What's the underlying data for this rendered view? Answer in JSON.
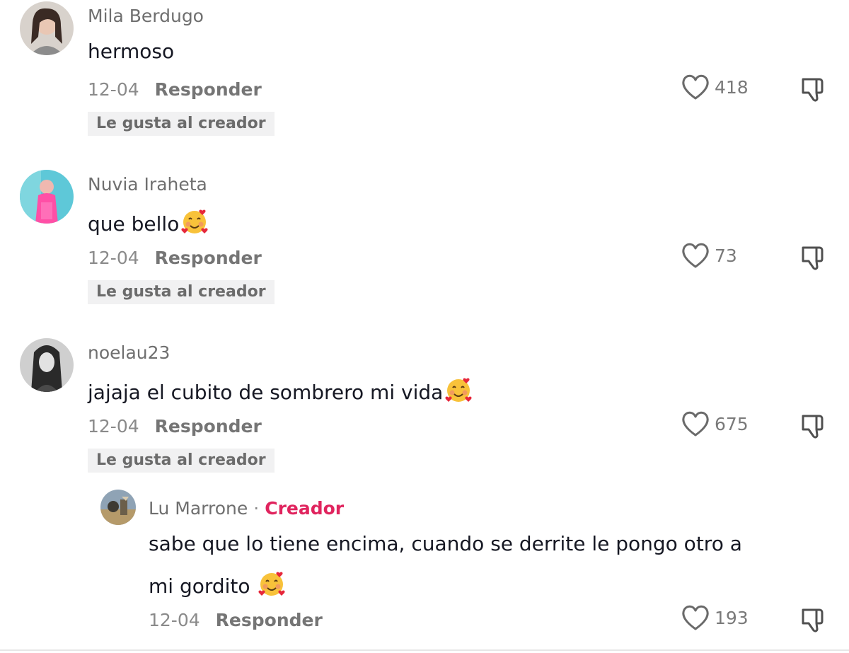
{
  "comments": [
    {
      "username": "Mila Berdugo",
      "text": "hermoso",
      "date": "12-04",
      "reply": "Responder",
      "badge": "Le gusta al creador",
      "likes": "418"
    },
    {
      "username": "Nuvia Iraheta",
      "text": "que bello",
      "date": "12-04",
      "reply": "Responder",
      "badge": "Le gusta al creador",
      "likes": "73"
    },
    {
      "username": "noelau23",
      "text": "jajaja el cubito de sombrero mi vida",
      "date": "12-04",
      "reply": "Responder",
      "badge": "Le gusta al creador",
      "likes": "675"
    }
  ],
  "reply_comment": {
    "username": "Lu Marrone",
    "separator": "·",
    "creator_label": "Creador",
    "text_line1": "sabe que lo tiene encima, cuando se derrite le pongo otro a",
    "text_line2": "mi gordito",
    "date": "12-04",
    "reply": "Responder",
    "likes": "193"
  },
  "icons": {
    "like": "heart-outline-icon",
    "dislike": "thumbs-down-icon",
    "emoji": "smiling-face-with-hearts-emoji"
  },
  "colors": {
    "creator": "#e0245e",
    "badge_bg": "#f1f1f2"
  }
}
